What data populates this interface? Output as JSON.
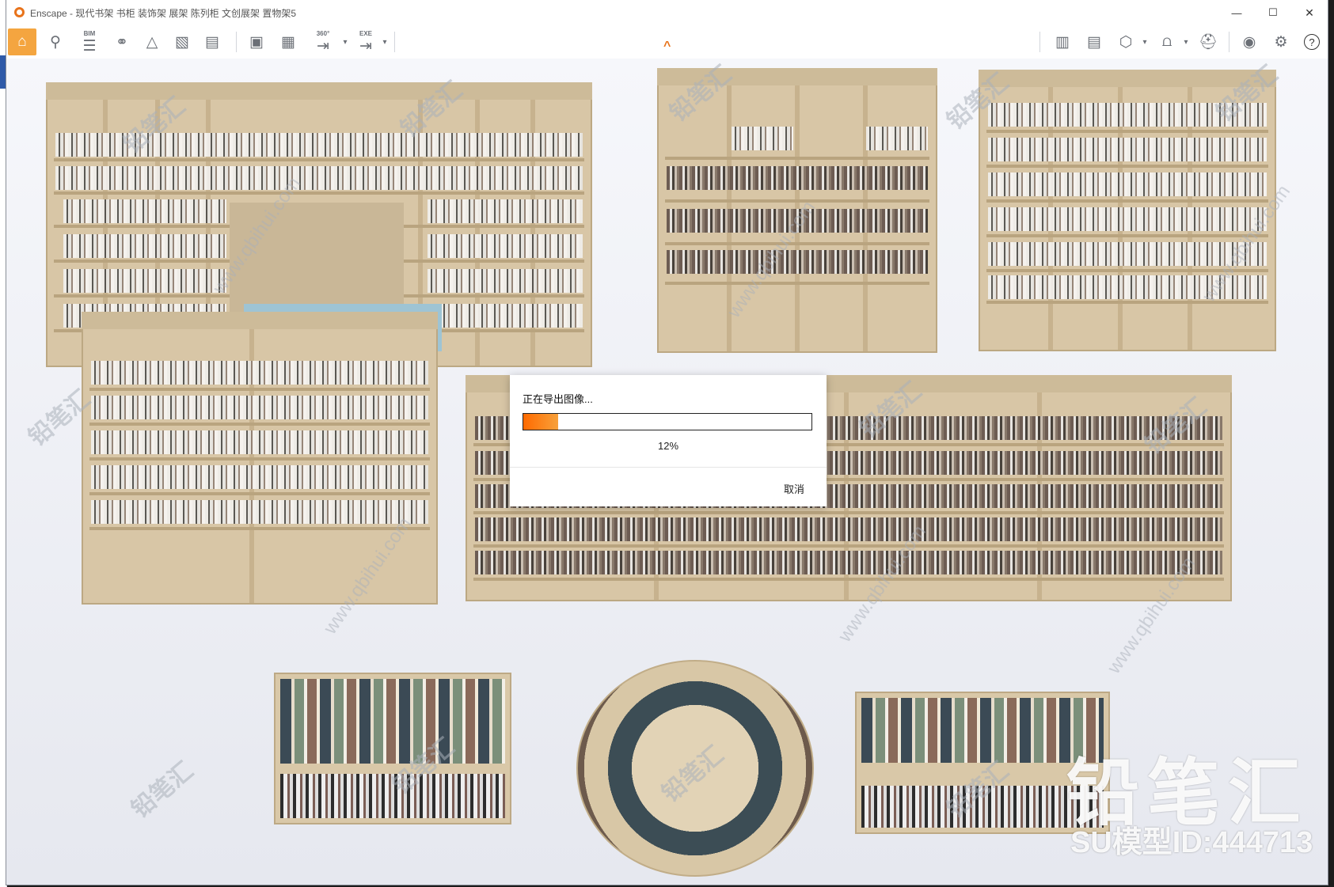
{
  "window": {
    "title": "Enscape - 现代书架 书柜 装饰架 展架 陈列柜 文创展架 置物架5",
    "controls": {
      "minimize": "—",
      "maximize": "☐",
      "close": "✕"
    }
  },
  "toolbar": {
    "bim_label": "BIM",
    "pano_label": "360°",
    "exe_label": "EXE",
    "help_label": "?"
  },
  "watermark": {
    "text": "铅笔汇",
    "url": "www.qbihui.com",
    "brand": "铅笔汇",
    "model_id": "SU模型ID:444713"
  },
  "dialog": {
    "title": "正在导出图像...",
    "progress_percent": 12,
    "percent_label": "12%",
    "cancel_label": "取消"
  },
  "colors": {
    "accent": "#f4a540",
    "progress_start": "#ff6a00",
    "progress_end": "#f7a13a"
  }
}
